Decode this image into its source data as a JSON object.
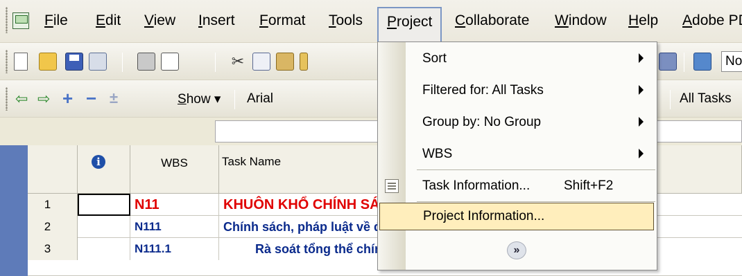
{
  "menubar": {
    "items": [
      "File",
      "Edit",
      "View",
      "Insert",
      "Format",
      "Tools",
      "Project",
      "Collaborate",
      "Window",
      "Help",
      "Adobe PDF"
    ]
  },
  "toolbar1": {
    "right_box_text": "No"
  },
  "toolbar2": {
    "show_label": "Show ▾",
    "font_name": "Arial",
    "filter_text": "All Tasks"
  },
  "grid": {
    "headers": {
      "wbs": "WBS",
      "task_name": "Task Name"
    },
    "rows": [
      {
        "num": "1",
        "wbs": "N11",
        "task": "KHUÔN KHỔ CHÍNH SÁCH"
      },
      {
        "num": "2",
        "wbs": "N111",
        "task": "Chính sách, pháp luật về đất đai và môi trường"
      },
      {
        "num": "3",
        "wbs": "N111.1",
        "task": "Rà soát tổng thể chính sách, pháp luật về đất đai và môi trường"
      }
    ]
  },
  "project_menu": {
    "items": [
      {
        "label": "Sort",
        "submenu": true
      },
      {
        "label": "Filtered for: All Tasks",
        "submenu": true
      },
      {
        "label": "Group by: No Group",
        "submenu": true
      },
      {
        "label": "WBS",
        "submenu": true
      },
      {
        "label": "Task Information...",
        "shortcut": "Shift+F2"
      },
      {
        "label": "Project Information...",
        "highlighted": true
      }
    ],
    "expand_glyph": "»"
  },
  "colors": {
    "menu_highlight": "#ffeebc",
    "row_header_bar": "#5e7bb9",
    "summary_red": "#e00000",
    "task_blue": "#0a2a8c"
  }
}
